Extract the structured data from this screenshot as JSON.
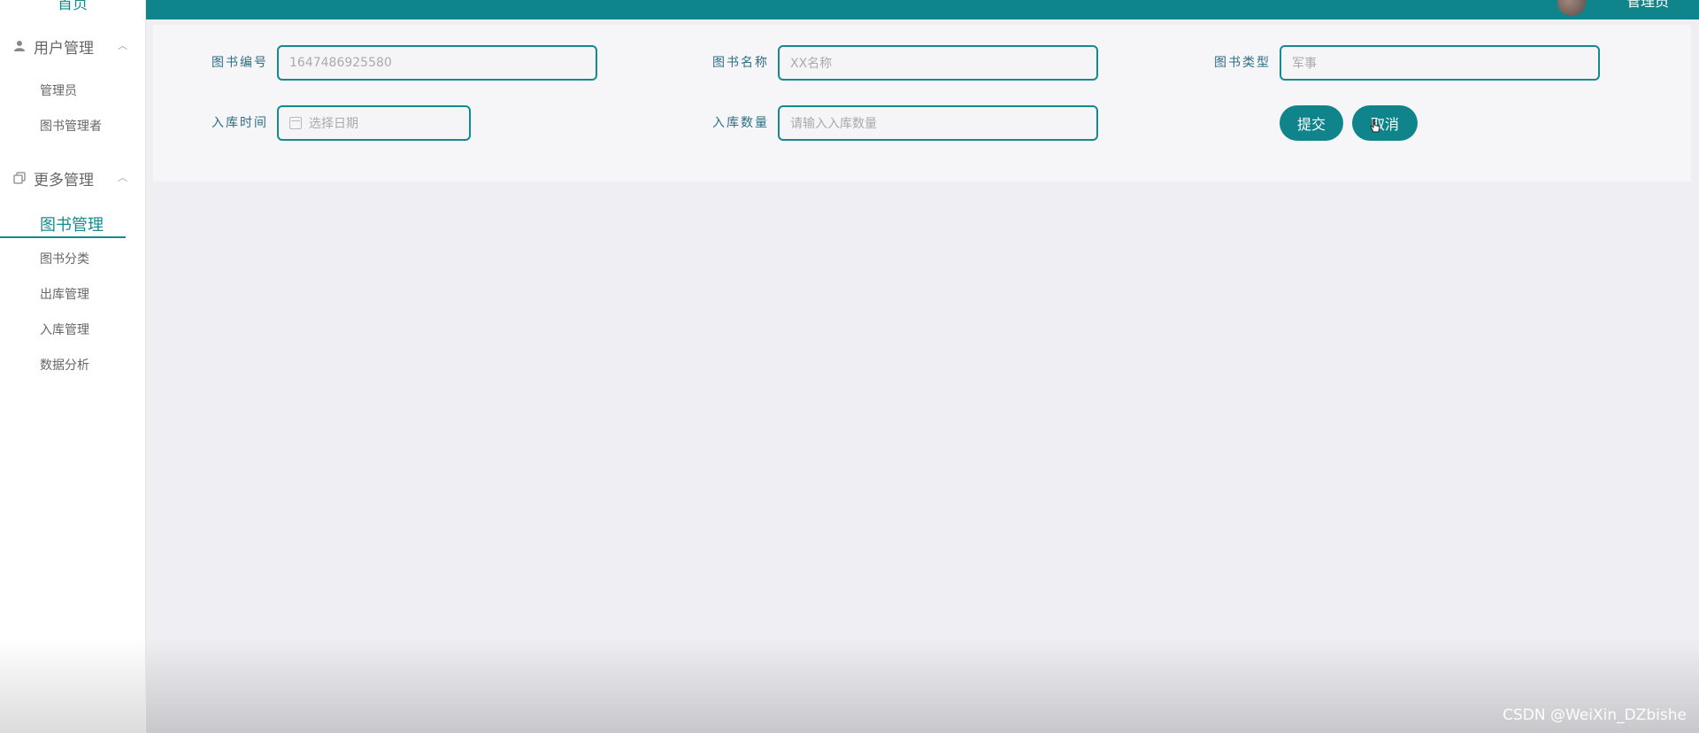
{
  "sidebar": {
    "top_label": "首页",
    "groups": [
      {
        "label": "用户管理",
        "icon": "user-icon",
        "items": [
          "管理员",
          "图书管理者"
        ]
      },
      {
        "label": "更多管理",
        "icon": "copy-icon",
        "items": [
          "图书管理",
          "图书分类",
          "出库管理",
          "入库管理",
          "数据分析"
        ]
      }
    ],
    "active_item": "图书管理"
  },
  "topbar": {
    "user_name": "管理员",
    "accent": "#0f848a"
  },
  "form": {
    "fields": [
      {
        "label": "图书编号",
        "value": "1647486925580"
      },
      {
        "label": "图书名称",
        "placeholder": "XX名称"
      },
      {
        "label": "图书类型",
        "value": "军事"
      },
      {
        "label": "入库时间",
        "placeholder": "选择日期"
      },
      {
        "label": "入库数量",
        "placeholder": "请输入入库数量"
      }
    ],
    "submit_label": "提交",
    "cancel_label": "取消"
  },
  "watermark": "CSDN @WeiXin_DZbishe"
}
